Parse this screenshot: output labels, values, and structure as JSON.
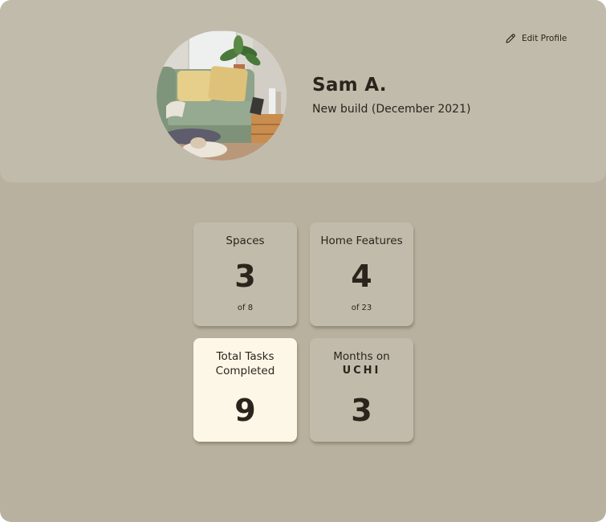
{
  "profile": {
    "name": "Sam A.",
    "subtitle": "New build (December 2021)",
    "edit_label": "Edit Profile"
  },
  "stats": {
    "spaces": {
      "title": "Spaces",
      "value": "3",
      "sub": "of 8"
    },
    "features": {
      "title": "Home Features",
      "value": "4",
      "sub": "of 23"
    },
    "tasks": {
      "title_line1": "Total Tasks",
      "title_line2": "Completed",
      "value": "9"
    },
    "months": {
      "title": "Months on",
      "brand": "UCHI",
      "value": "3"
    }
  },
  "colors": {
    "background": "#b8b19f",
    "header": "#c1bbab",
    "card": "#c1bbab",
    "highlight_card": "#fdf7e7",
    "text": "#2b241c"
  },
  "icons": {
    "edit": "pencil-icon",
    "avatar": "living-room-photo"
  }
}
